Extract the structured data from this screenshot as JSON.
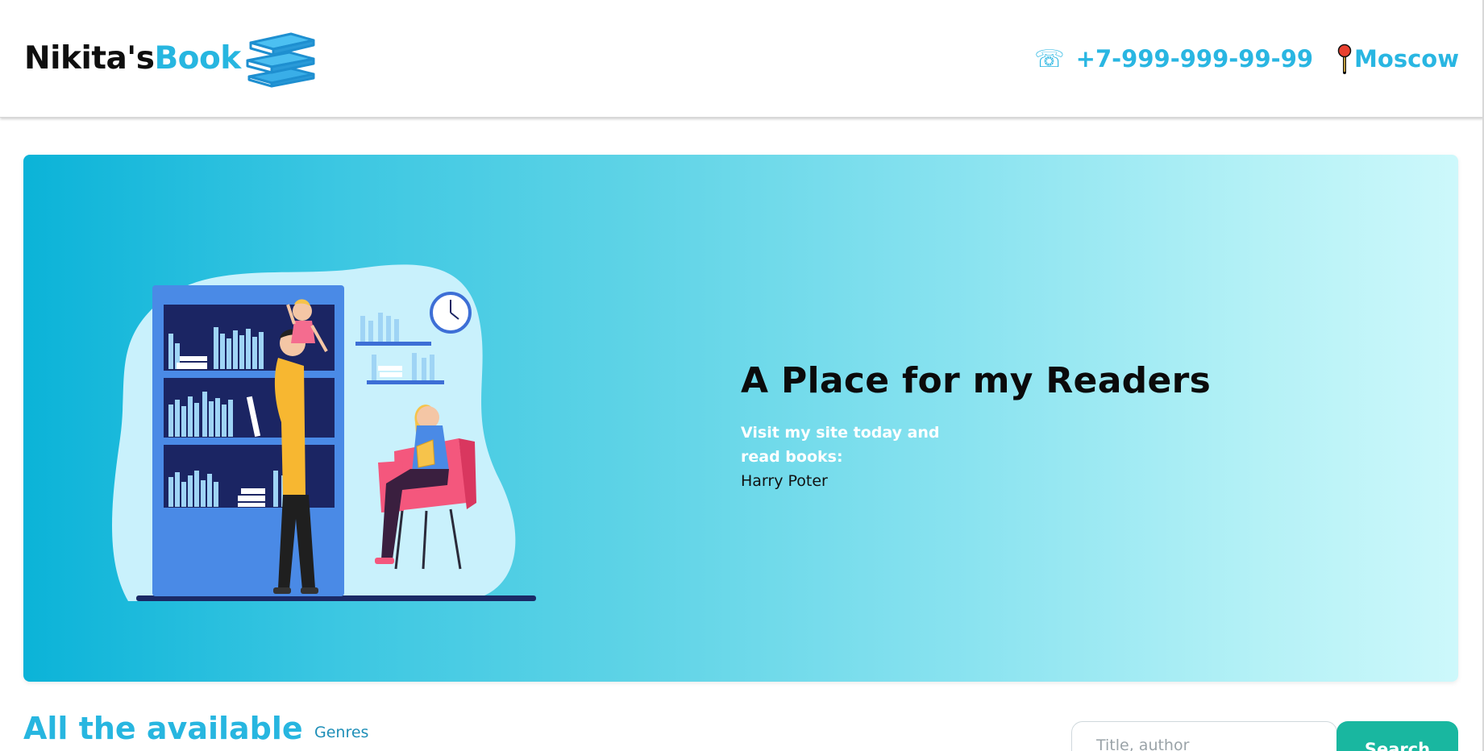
{
  "header": {
    "logo_part1": "Nikita's",
    "logo_part2": "Book",
    "phone_icon": "☏",
    "phone": "+7-999-999-99-99",
    "city": "Moscow"
  },
  "hero": {
    "title": "A Place for my Readers",
    "subtitle": "Visit my site today and read books:",
    "book": "Harry Poter"
  },
  "catalog": {
    "title": "All the available",
    "genres_link": "Genres",
    "search_placeholder": "Title, author",
    "search_button": "Search"
  },
  "colors": {
    "brand": "#27b6e0",
    "button": "#19b7a0",
    "hero_gradient_start": "#0bb3d8",
    "hero_gradient_end": "#cdf8fb"
  },
  "icons": {
    "logo": "books-stack-icon",
    "phone": "phone-icon",
    "location": "map-pin-icon",
    "hero": "family-reading-illustration"
  }
}
